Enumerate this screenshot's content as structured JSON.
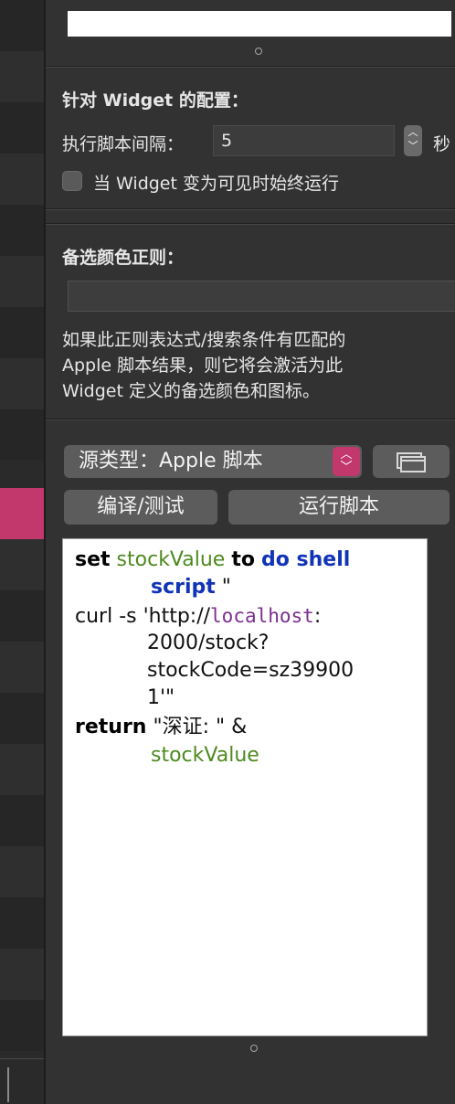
{
  "widget_config": {
    "heading": "针对 Widget 的配置：",
    "interval_label": "执行脚本间隔：",
    "interval_value": "5",
    "interval_unit": "秒",
    "always_run_label": "当 Widget 变为可见时始终运行"
  },
  "alt_color": {
    "heading": "备选颜色正则：",
    "regex_value": "",
    "description_lines": [
      "如果此正则表达式/搜索条件有匹配的",
      "Apple 脚本结果，则它将会激活为此",
      "Widget 定义的备选颜色和图标。"
    ]
  },
  "source": {
    "selected": "源类型：Apple 脚本"
  },
  "buttons": {
    "compile": "编译/测试",
    "run": "运行脚本"
  },
  "script": {
    "l1": [
      "set",
      "stockValue",
      "to",
      "do shell"
    ],
    "l2": [
      "script",
      "\""
    ],
    "l3": [
      "curl -s 'http://",
      "localhost",
      ":"
    ],
    "l4": "2000/stock?",
    "l5": "stockCode=sz39900",
    "l6": "1'\"",
    "l7": [
      "return",
      "\"深证: \" &"
    ],
    "l8": "stockValue"
  },
  "icons": {
    "stepper": "up-down-chevron-icon",
    "select_arrows": "up-down-chevron-icon",
    "window": "window-icon",
    "resize_dot": "resize-handle-icon"
  },
  "colors": {
    "accent": "#c2386d",
    "panel": "#323232",
    "keyword_green": "#4d8a1f",
    "keyword_blue": "#1033b8"
  }
}
